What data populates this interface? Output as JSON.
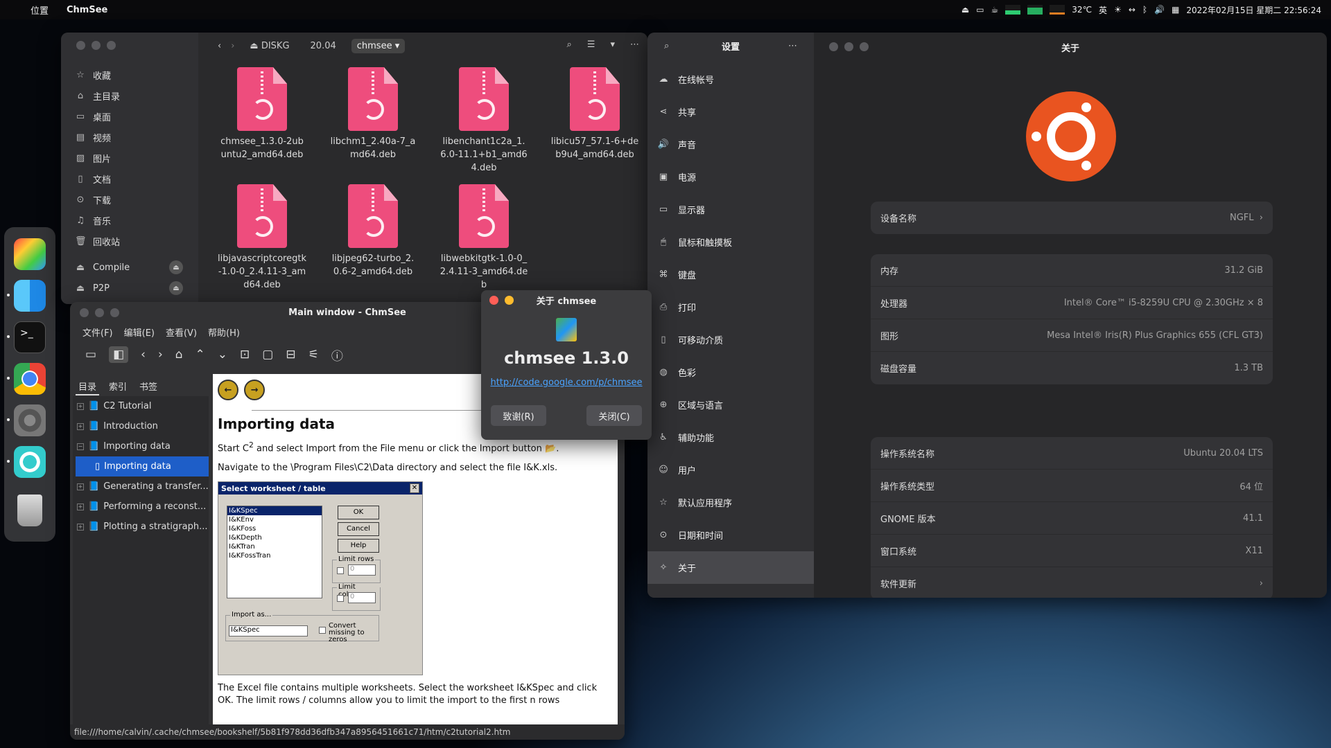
{
  "topbar": {
    "location": "位置",
    "app": "ChmSee",
    "temp": "32℃",
    "ime": "英",
    "datetime": "2022年02月15日 星期二 22:56:24"
  },
  "files": {
    "sidebar": [
      "收藏",
      "主目录",
      "桌面",
      "视频",
      "图片",
      "文档",
      "下载",
      "音乐",
      "回收站"
    ],
    "devices": [
      "Compile",
      "P2P"
    ],
    "crumbs": [
      "DISKG",
      "20.04",
      "chmsee"
    ],
    "items": [
      "chmsee_1.3.0-2ubuntu2_amd64.deb",
      "libchm1_2.40a-7_amd64.deb",
      "libenchant1c2a_1.6.0-11.1+b1_amd64.deb",
      "libicu57_57.1-6+deb9u4_amd64.deb",
      "libjavascriptcoregtk-1.0-0_2.4.11-3_amd64.deb",
      "libjpeg62-turbo_2.0.6-2_amd64.deb",
      "libwebkitgtk-1.0-0_2.4.11-3_amd64.deb"
    ]
  },
  "chmsee": {
    "title": "Main window - ChmSee",
    "menu": [
      "文件(F)",
      "编辑(E)",
      "查看(V)",
      "帮助(H)"
    ],
    "tabs": [
      "目录",
      "索引",
      "书签"
    ],
    "tree": [
      "C2 Tutorial",
      "Introduction",
      "Importing data",
      "Importing data",
      "Generating a transfer...",
      "Performing a reconst...",
      "Plotting a stratigraph..."
    ],
    "doc": {
      "heading": "Importing data",
      "p1a": "Start C",
      "sup": "2",
      "p1b": " and select Import from the File menu or click the Import button",
      "p2": "Navigate to the \\Program Files\\C2\\Data directory and select the file I&K.xls.",
      "p3": "The Excel file contains multiple worksheets. Select the worksheet I&KSpec and click OK. The limit rows / columns allow you to limit the import to the first n rows"
    },
    "dialog": {
      "title": "Select worksheet / table",
      "list": [
        "I&KSpec",
        "I&KEnv",
        "I&KFoss",
        "I&KDepth",
        "I&KTran",
        "I&KFossTran"
      ],
      "ok": "OK",
      "cancel": "Cancel",
      "help": "Help",
      "limit_rows": "Limit rows",
      "limit_cols": "Limit columns",
      "zero": "0",
      "import_as": "Import as...",
      "import_val": "I&KSpec",
      "convert": "Convert missing to zeros"
    },
    "status": "file:///home/calvin/.cache/chmsee/bookshelf/5b81f978dd36dfb347a8956451661c71/htm/c2tutorial2.htm"
  },
  "about": {
    "title": "关于 chmsee",
    "name": "chmsee 1.3.0",
    "link": "http://code.google.com/p/chmsee",
    "thanks": "致谢(R)",
    "close": "关闭(C)"
  },
  "settings": {
    "title": "设置",
    "about_title": "关于",
    "nav": [
      "在线帐号",
      "共享",
      "声音",
      "电源",
      "显示器",
      "鼠标和触摸板",
      "键盘",
      "打印",
      "可移动介质",
      "色彩",
      "区域与语言",
      "辅助功能",
      "用户",
      "默认应用程序",
      "日期和时间",
      "关于"
    ],
    "device": {
      "label": "设备名称",
      "value": "NGFL"
    },
    "hw": [
      {
        "k": "内存",
        "v": "31.2 GiB"
      },
      {
        "k": "处理器",
        "v": "Intel® Core™ i5-8259U CPU @ 2.30GHz × 8"
      },
      {
        "k": "图形",
        "v": "Mesa Intel® Iris(R) Plus Graphics 655 (CFL GT3)"
      },
      {
        "k": "磁盘容量",
        "v": "1.3 TB"
      }
    ],
    "os": [
      {
        "k": "操作系统名称",
        "v": "Ubuntu 20.04 LTS"
      },
      {
        "k": "操作系统类型",
        "v": "64 位"
      },
      {
        "k": "GNOME 版本",
        "v": "41.1"
      },
      {
        "k": "窗口系统",
        "v": "X11"
      },
      {
        "k": "软件更新",
        "v": ""
      }
    ]
  },
  "colors": {
    "ubuntu": "#e95420",
    "deb": "#ee4d7d",
    "selection": "#1e5ec8"
  }
}
